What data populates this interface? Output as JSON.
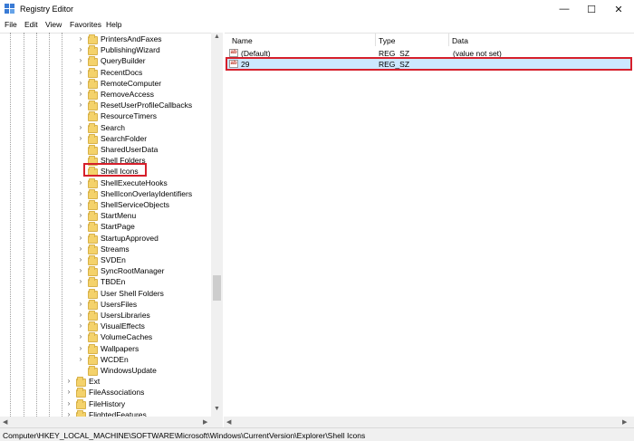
{
  "window": {
    "title": "Registry Editor",
    "minimize": "—",
    "maximize": "☐",
    "close": "✕"
  },
  "menu": [
    "File",
    "Edit",
    "View",
    "Favorites",
    "Help"
  ],
  "tree": {
    "keys": [
      "PrintersAndFaxes",
      "PublishingWizard",
      "QueryBuilder",
      "RecentDocs",
      "RemoteComputer",
      "RemoveAccess",
      "ResetUserProfileCallbacks",
      "ResourceTimers",
      "Search",
      "SearchFolder",
      "SharedUserData",
      "Shell Folders",
      "Shell Icons",
      "ShellExecuteHooks",
      "ShellIconOverlayIdentifiers",
      "ShellServiceObjects",
      "StartMenu",
      "StartPage",
      "StartupApproved",
      "Streams",
      "SVDEn",
      "SyncRootManager",
      "TBDEn",
      "User Shell Folders",
      "UsersFiles",
      "UsersLibraries",
      "VisualEffects",
      "VolumeCaches",
      "Wallpapers",
      "WCDEn",
      "WindowsUpdate"
    ],
    "expandable": [
      true,
      true,
      true,
      true,
      true,
      true,
      true,
      false,
      true,
      true,
      false,
      false,
      false,
      true,
      true,
      true,
      true,
      true,
      true,
      true,
      true,
      true,
      true,
      false,
      true,
      true,
      true,
      true,
      true,
      true,
      false
    ],
    "siblings": [
      "Ext",
      "FileAssociations",
      "FileHistory",
      "FlightedFeatures"
    ],
    "selected": "Shell Icons"
  },
  "values": {
    "columns": [
      "Name",
      "Type",
      "Data"
    ],
    "rows": [
      {
        "name": "(Default)",
        "type": "REG_SZ",
        "data": "(value not set)"
      },
      {
        "name": "29",
        "type": "REG_SZ",
        "data": ""
      }
    ]
  },
  "status": {
    "path": "Computer\\HKEY_LOCAL_MACHINE\\SOFTWARE\\Microsoft\\Windows\\CurrentVersion\\Explorer\\Shell Icons"
  },
  "colors": {
    "highlight": "#d61f2b",
    "selection": "#cce8ff",
    "folder": "#f4d26b"
  },
  "icons": {
    "key": "folder-icon",
    "value": "string-value-icon"
  }
}
